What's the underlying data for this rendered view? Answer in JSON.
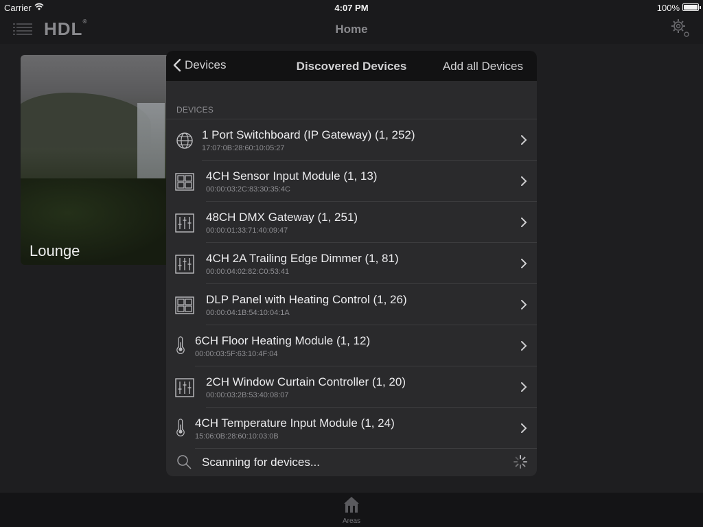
{
  "status_bar": {
    "carrier": "Carrier",
    "time": "4:07 PM",
    "battery": "100%"
  },
  "nav": {
    "logo": "HDL",
    "title": "Home"
  },
  "area_card": {
    "label": "Lounge"
  },
  "tab_bar": {
    "areas_label": "Areas"
  },
  "modal": {
    "back_label": "Devices",
    "title": "Discovered Devices",
    "add_all_label": "Add all Devices",
    "section_header": "DEVICES",
    "devices": [
      {
        "name": "1 Port Switchboard (IP Gateway) (1, 252)",
        "mac": "17:07:0B:28:60:10:05:27",
        "icon": "globe-icon"
      },
      {
        "name": "4CH Sensor Input Module (1, 13)",
        "mac": "00:00:03:2C:83:30:35:4C",
        "icon": "grid-panel-icon"
      },
      {
        "name": "48CH DMX Gateway (1, 251)",
        "mac": "00:00:01:33:71:40:09:47",
        "icon": "sliders-icon"
      },
      {
        "name": "4CH 2A Trailing Edge Dimmer (1, 81)",
        "mac": "00:00:04:02:82:C0:53:41",
        "icon": "sliders-icon"
      },
      {
        "name": "DLP Panel with Heating Control (1, 26)",
        "mac": "00:00:04:1B:54:10:04:1A",
        "icon": "grid-panel-icon"
      },
      {
        "name": "6CH Floor Heating Module (1, 12)",
        "mac": "00:00:03:5F:63:10:4F:04",
        "icon": "thermometer-icon"
      },
      {
        "name": "2CH Window Curtain Controller (1, 20)",
        "mac": "00:00:03:2B:53:40:08:07",
        "icon": "sliders-icon"
      },
      {
        "name": "4CH Temperature Input Module (1, 24)",
        "mac": "15:06:0B:28:60:10:03:0B",
        "icon": "thermometer-icon"
      }
    ],
    "scanning_text": "Scanning for devices..."
  }
}
